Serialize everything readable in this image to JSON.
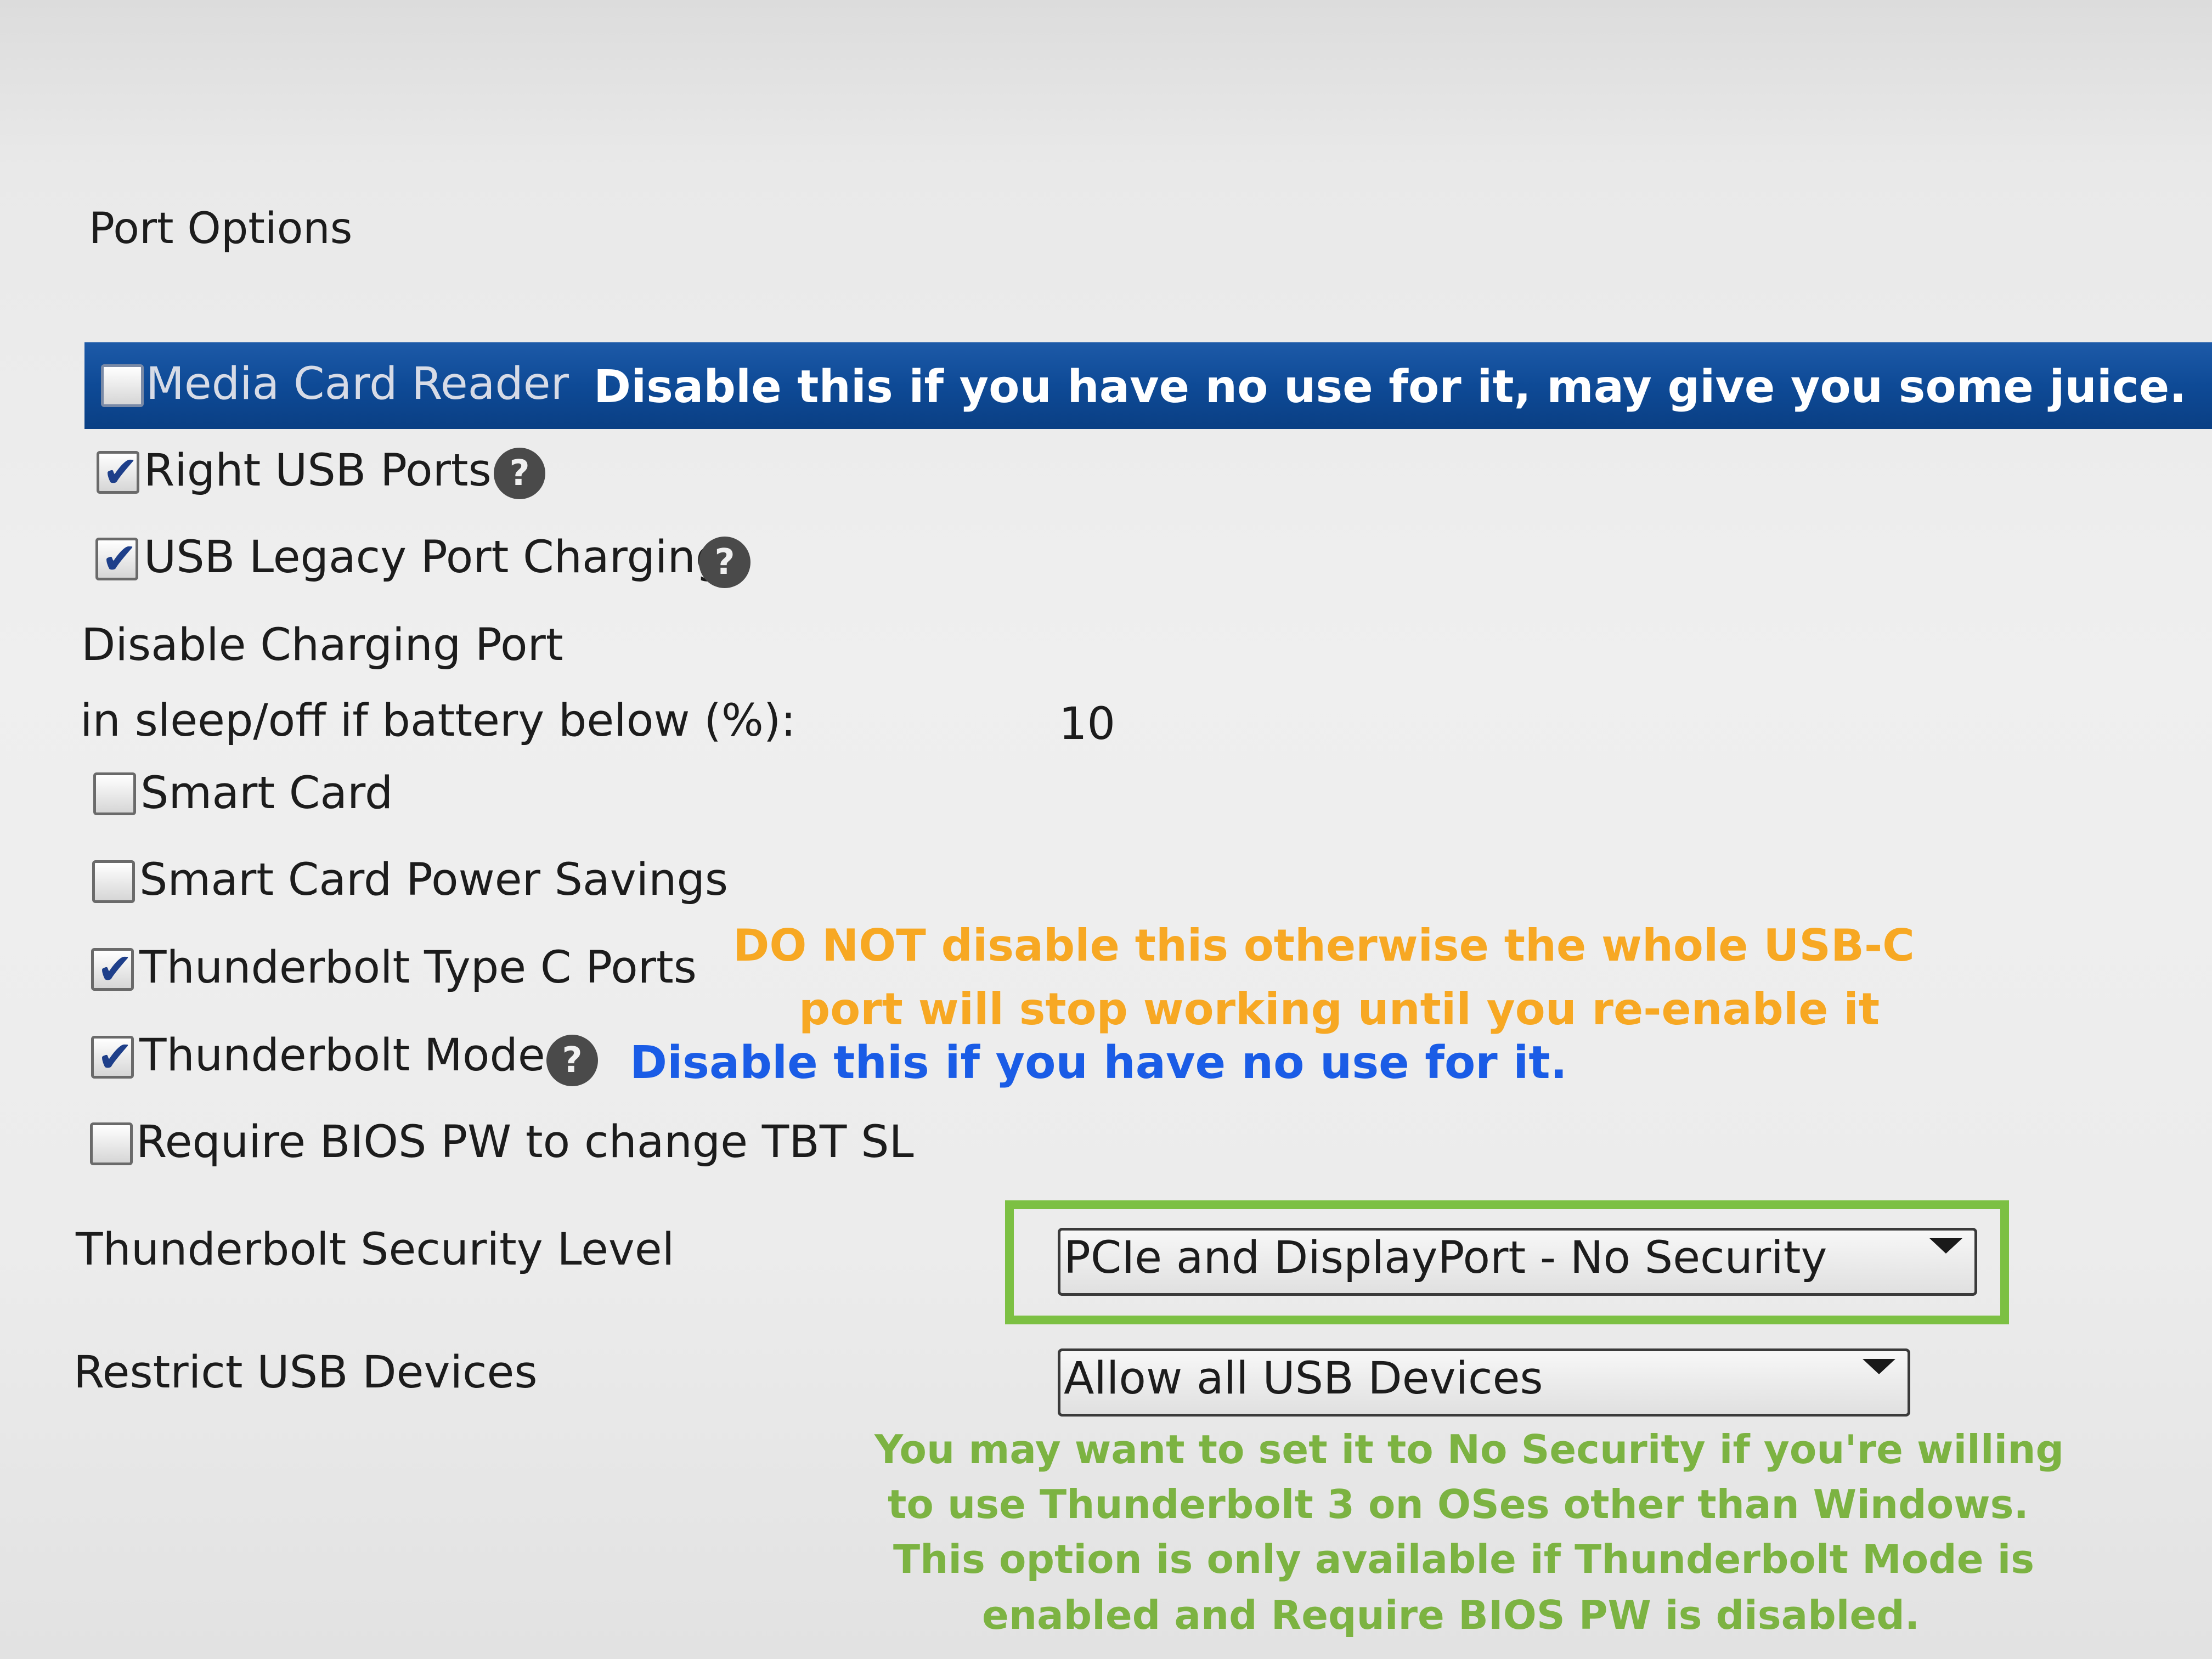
{
  "section_title": "Port Options",
  "items": {
    "media_card_reader": {
      "label": "Media Card Reader",
      "checked": false
    },
    "right_usb_ports": {
      "label": "Right USB Ports",
      "checked": true
    },
    "usb_legacy_port_charging": {
      "label": "USB Legacy Port Charging",
      "checked": true
    },
    "disable_charging_port": {
      "label_line1": "Disable Charging Port",
      "label_line2": "in sleep/off if battery below (%):",
      "value": "10"
    },
    "smart_card": {
      "label": "Smart Card",
      "checked": false
    },
    "smart_card_power_savings": {
      "label": "Smart Card Power Savings",
      "checked": false
    },
    "thunderbolt_type_c_ports": {
      "label": "Thunderbolt Type C Ports",
      "checked": true
    },
    "thunderbolt_mode": {
      "label": "Thunderbolt Mode",
      "checked": true
    },
    "require_bios_pw": {
      "label": "Require BIOS PW to change TBT SL",
      "checked": false
    }
  },
  "thunderbolt_security_level": {
    "label": "Thunderbolt Security Level",
    "selected": "PCIe and DisplayPort - No Security"
  },
  "restrict_usb_devices": {
    "label": "Restrict USB Devices",
    "selected": "Allow all USB Devices"
  },
  "help_glyph": "?",
  "check_glyph": "✔",
  "annotations": {
    "media_card": "Disable this if you have no use for it, may give you some juice.",
    "thunderbolt_ports_line1": "DO NOT disable this otherwise the whole USB-C",
    "thunderbolt_ports_line2": "port will stop working until you re-enable it",
    "thunderbolt_mode": "Disable this if you have no use for it.",
    "security_line1": "You may want to set it to No Security if you're willing",
    "security_line2": "to use Thunderbolt 3 on OSes other than Windows.",
    "security_line3": "This option is only available if Thunderbolt Mode is",
    "security_line4": "enabled and Require BIOS PW is disabled."
  },
  "colors": {
    "highlight": "#0e4a96",
    "annotation_white": "#ffffff",
    "annotation_orange": "#f7a823",
    "annotation_blue": "#1a5ce6",
    "annotation_green": "#7cb342",
    "green_frame": "#7cc043"
  }
}
